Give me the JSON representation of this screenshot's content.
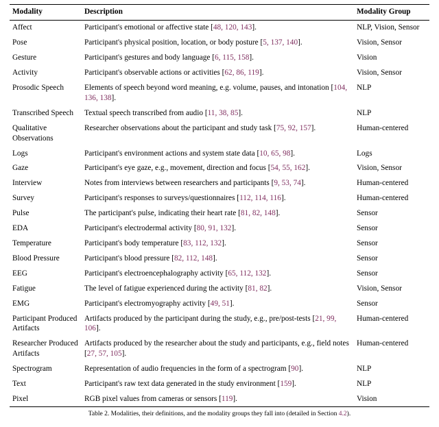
{
  "table": {
    "headers": [
      "Modality",
      "Description",
      "Modality Group"
    ],
    "rows": [
      {
        "modality": "Affect",
        "pre": "Participant's emotional or affective state [",
        "cites": "48, 120, 143",
        "post": "].",
        "group": "NLP, Vision, Sensor"
      },
      {
        "modality": "Pose",
        "pre": "Participant's physical position, location, or body posture [",
        "cites": "5, 137, 140",
        "post": "].",
        "group": "Vision, Sensor"
      },
      {
        "modality": "Gesture",
        "pre": "Participant's gestures and body language [",
        "cites": "6, 115, 158",
        "post": "].",
        "group": "Vision"
      },
      {
        "modality": "Activity",
        "pre": "Participant's observable actions or activities [",
        "cites": "62, 86, 119",
        "post": "].",
        "group": "Vision, Sensor"
      },
      {
        "modality": "Prosodic Speech",
        "pre": "Elements of speech beyond word meaning, e.g. volume, pauses, and intonation [",
        "cites": "104, 136, 138",
        "post": "].",
        "group": "NLP"
      },
      {
        "modality": "Transcribed Speech",
        "pre": "Textual speech transcribed from audio [",
        "cites": "11, 38, 85",
        "post": "].",
        "group": "NLP"
      },
      {
        "modality": "Qualitative Observations",
        "pre": "Researcher observations about the participant and study task [",
        "cites": "75, 92, 157",
        "post": "].",
        "group": "Human-centered"
      },
      {
        "modality": "Logs",
        "pre": "Participant's environment actions and system state data [",
        "cites": "10, 65, 98",
        "post": "].",
        "group": "Logs"
      },
      {
        "modality": "Gaze",
        "pre": "Participant's eye gaze, e.g., movement, direction and focus [",
        "cites": "54, 55, 162",
        "post": "].",
        "group": "Vision, Sensor"
      },
      {
        "modality": "Interview",
        "pre": "Notes from interviews between researchers and participants [",
        "cites": "9, 53, 74",
        "post": "].",
        "group": "Human-centered"
      },
      {
        "modality": "Survey",
        "pre": "Participant's responses to surveys/questionnaires [",
        "cites": "112, 114, 116",
        "post": "].",
        "group": "Human-centered"
      },
      {
        "modality": "Pulse",
        "pre": "The participant's pulse, indicating their heart rate [",
        "cites": "81, 82, 148",
        "post": "].",
        "group": "Sensor"
      },
      {
        "modality": "EDA",
        "pre": "Participant's electrodermal activity [",
        "cites": "80, 91, 132",
        "post": "].",
        "group": "Sensor"
      },
      {
        "modality": "Temperature",
        "pre": "Participant's body temperature [",
        "cites": "83, 112, 132",
        "post": "].",
        "group": "Sensor"
      },
      {
        "modality": "Blood Pressure",
        "pre": "Participant's blood pressure [",
        "cites": "82, 112, 148",
        "post": "].",
        "group": "Sensor"
      },
      {
        "modality": "EEG",
        "pre": "Participant's electroencephalography activity [",
        "cites": "65, 112, 132",
        "post": "].",
        "group": "Sensor"
      },
      {
        "modality": "Fatigue",
        "pre": "The level of fatigue experienced during the activity [",
        "cites": "81, 82",
        "post": "].",
        "group": "Vision, Sensor"
      },
      {
        "modality": "EMG",
        "pre": "Participant's electromyography activity [",
        "cites": "49, 51",
        "post": "].",
        "group": "Sensor"
      },
      {
        "modality": "Participant Produced Artifacts",
        "pre": "Artifacts produced by the participant during the study, e.g., pre/post-tests [",
        "cites": "21, 99, 106",
        "post": "].",
        "group": "Human-centered"
      },
      {
        "modality": "Researcher Produced Artifacts",
        "pre": "Artifacts produced by the researcher about the study and participants, e.g., field notes [",
        "cites": "27, 57, 105",
        "post": "].",
        "group": "Human-centered"
      },
      {
        "modality": "Spectrogram",
        "pre": "Representation of audio frequencies in the form of a spectrogram [",
        "cites": "90",
        "post": "].",
        "group": "NLP"
      },
      {
        "modality": "Text",
        "pre": "Participant's raw text data generated in the study environment [",
        "cites": "159",
        "post": "].",
        "group": "NLP"
      },
      {
        "modality": "Pixel",
        "pre": "RGB pixel values from cameras or sensors [",
        "cites": "119",
        "post": "].",
        "group": "Vision"
      }
    ],
    "caption_pre": "Table 2.  Modalities, their definitions, and the modality groups they fall into (detailed in Section ",
    "caption_link": "4.2",
    "caption_post": ")."
  }
}
